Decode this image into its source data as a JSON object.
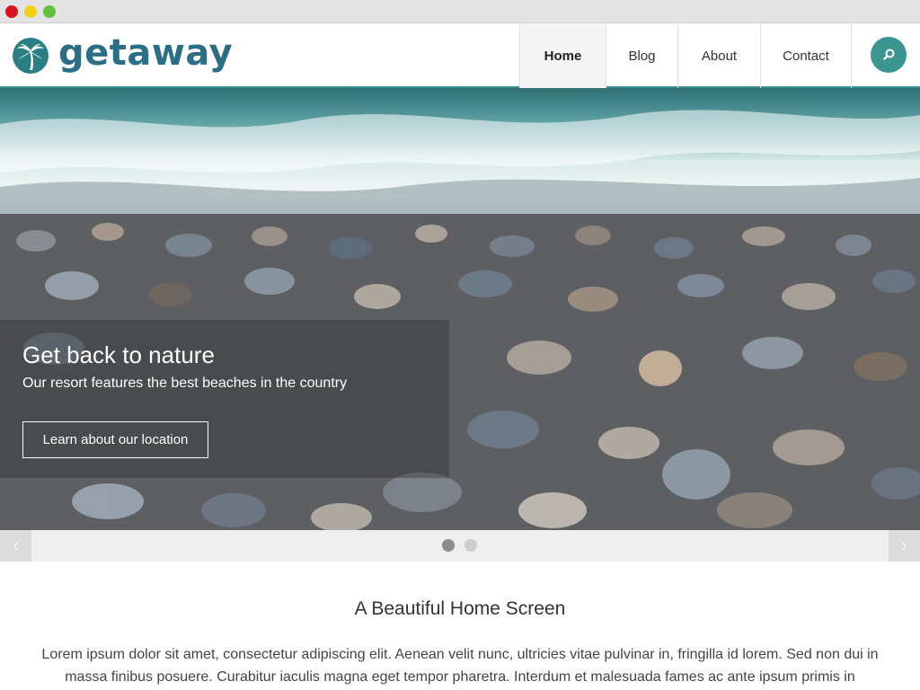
{
  "brand": {
    "name": "getaway",
    "accent_color": "#3b9692",
    "logo_color": "#2b6f86"
  },
  "nav": {
    "items": [
      {
        "label": "Home",
        "active": true
      },
      {
        "label": "Blog",
        "active": false
      },
      {
        "label": "About",
        "active": false
      },
      {
        "label": "Contact",
        "active": false
      }
    ],
    "search_icon": "search-icon"
  },
  "hero": {
    "title": "Get back to nature",
    "subtitle": "Our resort features the best beaches in the country",
    "button_label": "Learn about our location"
  },
  "slider": {
    "prev_label": "‹",
    "next_label": "›",
    "slide_count": 2,
    "active_index": 0
  },
  "content": {
    "title": "A Beautiful Home Screen",
    "body": "Lorem ipsum dolor sit amet, consectetur adipiscing elit. Aenean velit nunc, ultricies vitae pulvinar in, fringilla id lorem. Sed non dui in massa finibus posuere. Curabitur iaculis magna eget tempor pharetra. Interdum et malesuada fames ac ante ipsum primis in"
  }
}
